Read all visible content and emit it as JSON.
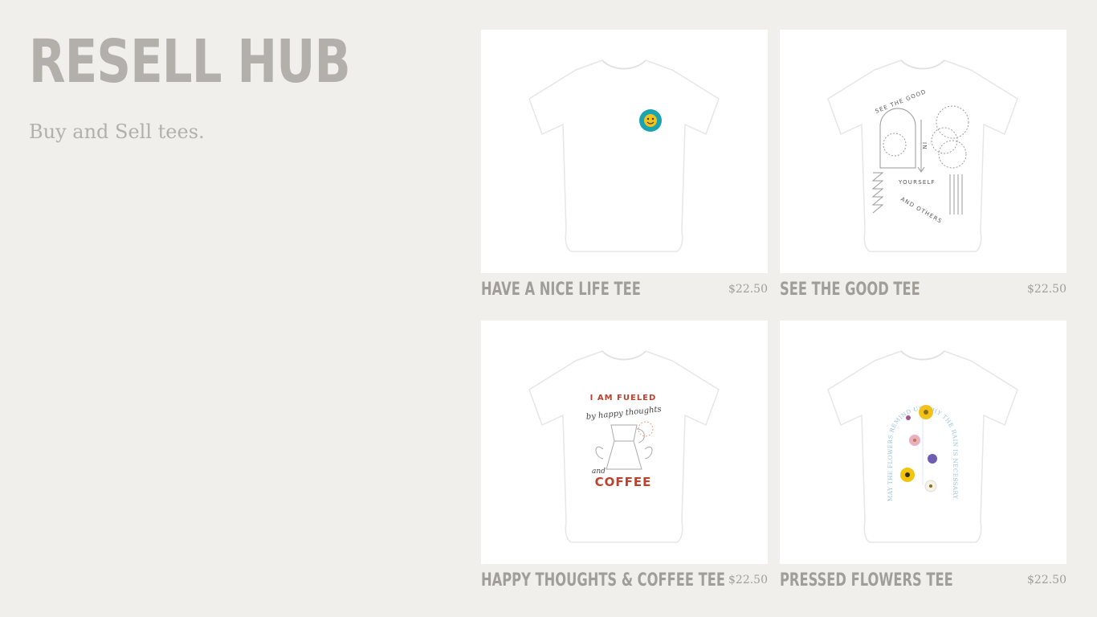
{
  "header": {
    "brand": "RESELL HUB",
    "tagline": "Buy and Sell tees."
  },
  "products": [
    {
      "title": "HAVE A NICE LIFE TEE",
      "price": "$22.50",
      "graphic": "smiley-badge-icon"
    },
    {
      "title": "SEE THE GOOD TEE",
      "price": "$22.50",
      "graphic": "see-the-good-line-art",
      "print_text": [
        "SEE THE GOOD",
        "IN",
        "YOURSELF",
        "AND OTHERS"
      ]
    },
    {
      "title": "HAPPY THOUGHTS & COFFEE TEE",
      "price": "$22.50",
      "graphic": "moka-pot-illustration",
      "print_text": [
        "I AM FUELED",
        "by happy thoughts",
        "and",
        "COFFEE"
      ]
    },
    {
      "title": "PRESSED FLOWERS TEE",
      "price": "$22.50",
      "graphic": "pressed-flowers-arch",
      "print_text": [
        "MAY THE FLOWERS REMIND US WHY THE RAIN IS NECESSARY"
      ]
    }
  ],
  "colors": {
    "background": "#f0efeb",
    "text_muted": "#b3b0ac",
    "product_text": "#a19e99",
    "card_bg": "#ffffff",
    "coffee_red": "#b8432e",
    "badge_teal": "#1aa3b0",
    "badge_yellow": "#f2c21b",
    "flower_text_blue": "#9bc4dc"
  }
}
